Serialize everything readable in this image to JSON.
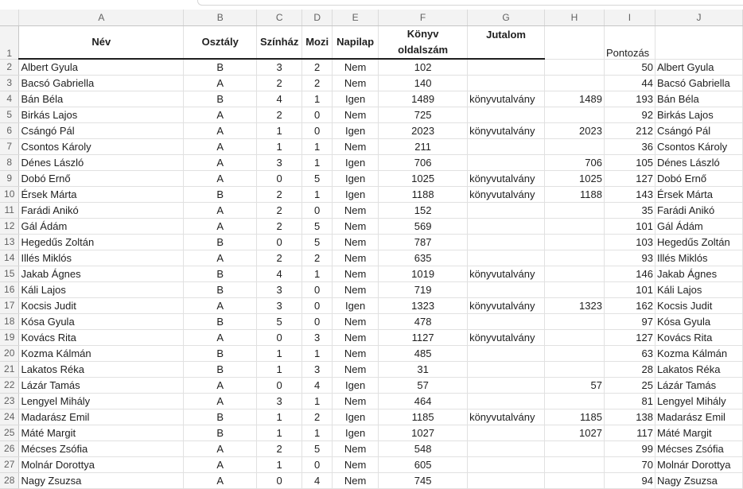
{
  "columns": [
    "A",
    "B",
    "C",
    "D",
    "E",
    "F",
    "G",
    "H",
    "I",
    "J"
  ],
  "header": {
    "row_number": "1",
    "nev": "Név",
    "osztaly": "Osztály",
    "szinhaz": "Színház",
    "mozi": "Mozi",
    "napilap": "Napilap",
    "konyv": "Könyv oldalszám",
    "jutalom": "Jutalom",
    "h": "",
    "pontozas": "Pontozás",
    "j": ""
  },
  "rows": [
    {
      "n": "2",
      "a": "Albert Gyula",
      "b": "B",
      "c": "3",
      "d": "2",
      "e": "Nem",
      "f": "102",
      "g": "",
      "h": "",
      "i": "50",
      "j": "Albert Gyula"
    },
    {
      "n": "3",
      "a": "Bacsó Gabriella",
      "b": "A",
      "c": "2",
      "d": "2",
      "e": "Nem",
      "f": "140",
      "g": "",
      "h": "",
      "i": "44",
      "j": "Bacsó Gabriella"
    },
    {
      "n": "4",
      "a": "Bán Béla",
      "b": "B",
      "c": "4",
      "d": "1",
      "e": "Igen",
      "f": "1489",
      "g": "könyvutalvány",
      "h": "1489",
      "i": "193",
      "j": "Bán Béla"
    },
    {
      "n": "5",
      "a": "Birkás Lajos",
      "b": "A",
      "c": "2",
      "d": "0",
      "e": "Nem",
      "f": "725",
      "g": "",
      "h": "",
      "i": "92",
      "j": "Birkás Lajos"
    },
    {
      "n": "6",
      "a": "Csángó Pál",
      "b": "A",
      "c": "1",
      "d": "0",
      "e": "Igen",
      "f": "2023",
      "g": "könyvutalvány",
      "h": "2023",
      "i": "212",
      "j": "Csángó Pál"
    },
    {
      "n": "7",
      "a": "Csontos Károly",
      "b": "A",
      "c": "1",
      "d": "1",
      "e": "Nem",
      "f": "211",
      "g": "",
      "h": "",
      "i": "36",
      "j": "Csontos Károly"
    },
    {
      "n": "8",
      "a": "Dénes László",
      "b": "A",
      "c": "3",
      "d": "1",
      "e": "Igen",
      "f": "706",
      "g": "",
      "h": "706",
      "i": "105",
      "j": "Dénes László"
    },
    {
      "n": "9",
      "a": "Dobó Ernő",
      "b": "A",
      "c": "0",
      "d": "5",
      "e": "Igen",
      "f": "1025",
      "g": "könyvutalvány",
      "h": "1025",
      "i": "127",
      "j": "Dobó Ernő"
    },
    {
      "n": "10",
      "a": "Érsek Márta",
      "b": "B",
      "c": "2",
      "d": "1",
      "e": "Igen",
      "f": "1188",
      "g": "könyvutalvány",
      "h": "1188",
      "i": "143",
      "j": "Érsek Márta"
    },
    {
      "n": "11",
      "a": "Farádi Anikó",
      "b": "A",
      "c": "2",
      "d": "0",
      "e": "Nem",
      "f": "152",
      "g": "",
      "h": "",
      "i": "35",
      "j": "Farádi Anikó"
    },
    {
      "n": "12",
      "a": "Gál Ádám",
      "b": "A",
      "c": "2",
      "d": "5",
      "e": "Nem",
      "f": "569",
      "g": "",
      "h": "",
      "i": "101",
      "j": "Gál Ádám"
    },
    {
      "n": "13",
      "a": "Hegedűs Zoltán",
      "b": "B",
      "c": "0",
      "d": "5",
      "e": "Nem",
      "f": "787",
      "g": "",
      "h": "",
      "i": "103",
      "j": "Hegedűs Zoltán"
    },
    {
      "n": "14",
      "a": "Illés Miklós",
      "b": "A",
      "c": "2",
      "d": "2",
      "e": "Nem",
      "f": "635",
      "g": "",
      "h": "",
      "i": "93",
      "j": "Illés Miklós"
    },
    {
      "n": "15",
      "a": "Jakab Ágnes",
      "b": "B",
      "c": "4",
      "d": "1",
      "e": "Nem",
      "f": "1019",
      "g": "könyvutalvány",
      "h": "",
      "i": "146",
      "j": "Jakab Ágnes"
    },
    {
      "n": "16",
      "a": "Káli Lajos",
      "b": "B",
      "c": "3",
      "d": "0",
      "e": "Nem",
      "f": "719",
      "g": "",
      "h": "",
      "i": "101",
      "j": "Káli Lajos"
    },
    {
      "n": "17",
      "a": "Kocsis Judit",
      "b": "A",
      "c": "3",
      "d": "0",
      "e": "Igen",
      "f": "1323",
      "g": "könyvutalvány",
      "h": "1323",
      "i": "162",
      "j": "Kocsis Judit"
    },
    {
      "n": "18",
      "a": "Kósa Gyula",
      "b": "B",
      "c": "5",
      "d": "0",
      "e": "Nem",
      "f": "478",
      "g": "",
      "h": "",
      "i": "97",
      "j": "Kósa Gyula"
    },
    {
      "n": "19",
      "a": "Kovács Rita",
      "b": "A",
      "c": "0",
      "d": "3",
      "e": "Nem",
      "f": "1127",
      "g": "könyvutalvány",
      "h": "",
      "i": "127",
      "j": "Kovács Rita"
    },
    {
      "n": "20",
      "a": "Kozma Kálmán",
      "b": "B",
      "c": "1",
      "d": "1",
      "e": "Nem",
      "f": "485",
      "g": "",
      "h": "",
      "i": "63",
      "j": "Kozma Kálmán"
    },
    {
      "n": "21",
      "a": "Lakatos Réka",
      "b": "B",
      "c": "1",
      "d": "3",
      "e": "Nem",
      "f": "31",
      "g": "",
      "h": "",
      "i": "28",
      "j": "Lakatos Réka"
    },
    {
      "n": "22",
      "a": "Lázár Tamás",
      "b": "A",
      "c": "0",
      "d": "4",
      "e": "Igen",
      "f": "57",
      "g": "",
      "h": "57",
      "i": "25",
      "j": "Lázár Tamás"
    },
    {
      "n": "23",
      "a": "Lengyel Mihály",
      "b": "A",
      "c": "3",
      "d": "1",
      "e": "Nem",
      "f": "464",
      "g": "",
      "h": "",
      "i": "81",
      "j": "Lengyel Mihály"
    },
    {
      "n": "24",
      "a": "Madarász Emil",
      "b": "B",
      "c": "1",
      "d": "2",
      "e": "Igen",
      "f": "1185",
      "g": "könyvutalvány",
      "h": "1185",
      "i": "138",
      "j": "Madarász Emil"
    },
    {
      "n": "25",
      "a": "Máté Margit",
      "b": "B",
      "c": "1",
      "d": "1",
      "e": "Igen",
      "f": "1027",
      "g": "",
      "h": "1027",
      "i": "117",
      "j": "Máté Margit"
    },
    {
      "n": "26",
      "a": "Mécses Zsófia",
      "b": "A",
      "c": "2",
      "d": "5",
      "e": "Nem",
      "f": "548",
      "g": "",
      "h": "",
      "i": "99",
      "j": "Mécses Zsófia"
    },
    {
      "n": "27",
      "a": "Molnár Dorottya",
      "b": "A",
      "c": "1",
      "d": "0",
      "e": "Nem",
      "f": "605",
      "g": "",
      "h": "",
      "i": "70",
      "j": "Molnár Dorottya"
    },
    {
      "n": "28",
      "a": "Nagy Zsuzsa",
      "b": "A",
      "c": "0",
      "d": "4",
      "e": "Nem",
      "f": "745",
      "g": "",
      "h": "",
      "i": "94",
      "j": "Nagy Zsuzsa"
    }
  ]
}
